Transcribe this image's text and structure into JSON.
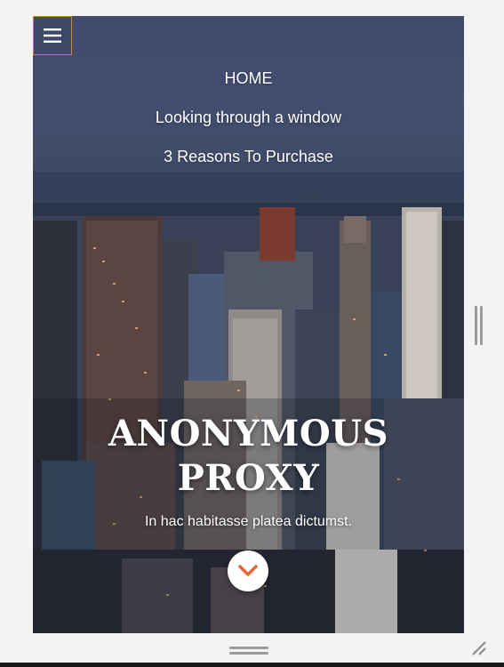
{
  "menu": {
    "toggle_icon": "hamburger-menu-icon",
    "items": [
      {
        "label": "HOME"
      },
      {
        "label": "Looking through a window"
      },
      {
        "label": "3 Reasons To Purchase"
      }
    ]
  },
  "hero": {
    "title_line1": "ANONYMOUS",
    "title_line2": "PROXY",
    "subtitle": "In hac habitasse platea dictumst.",
    "scroll_icon": "chevron-down-icon",
    "accent_color": "#e8643a"
  }
}
